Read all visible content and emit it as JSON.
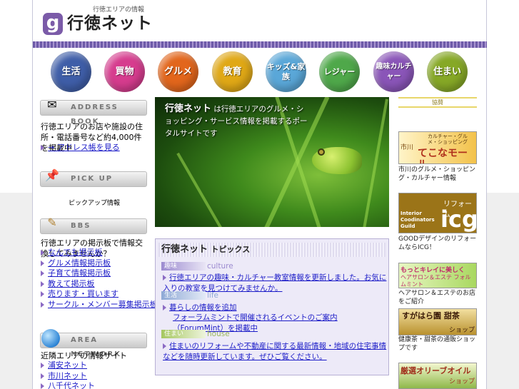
{
  "header": {
    "tagline": "行徳エリアの情報",
    "logo_letter": "g",
    "logo_text": "行徳ネット"
  },
  "categories": [
    {
      "label": "生活",
      "icon": "building-icon",
      "color": "#3f5ea8"
    },
    {
      "label": "買物",
      "icon": "bag-icon",
      "color": "#d63c8e"
    },
    {
      "label": "グルメ",
      "icon": "fork-icon",
      "color": "#e2661c"
    },
    {
      "label": "教育",
      "icon": "pencil-icon",
      "color": "#e0a816"
    },
    {
      "label": "キッズ&家族",
      "icon": "kids-icon",
      "color": "#5aa7d8"
    },
    {
      "label": "レジャー",
      "icon": "leisure-icon",
      "color": "#4fa84a"
    },
    {
      "label": "趣味カルチャー",
      "icon": "culture-icon",
      "color": "#8a55b8"
    },
    {
      "label": "住まい",
      "icon": "house-icon",
      "color": "#86a826"
    }
  ],
  "sidebar": {
    "address": {
      "title": "ADDRESS BOOK",
      "description": "行徳エリアのお店や施設の住所・電話番号など約4,000件を掲載中",
      "link": "→ アドレス帳を見る"
    },
    "pickup": {
      "title": "PICK UP",
      "text": "ピックアップ情報"
    },
    "bbs": {
      "title": "BBS",
      "description": "行徳エリアの掲示板で情報交換してみませんか？",
      "links": [
        "なんでも掲示板",
        "グルメ情報掲示板",
        "子育て情報掲示板",
        "教えて掲示板",
        "売ります・買います",
        "サークル・メンバー募集掲示板"
      ]
    },
    "area": {
      "title": "AREA NETWORK",
      "description": "近隣エリアの情報サイト",
      "links": [
        "浦安ネット",
        "市川ネット",
        "八千代ネット"
      ]
    }
  },
  "hero": {
    "brand": "行徳ネット",
    "text": "は行徳エリアのグルメ・ショッピング・サービス情報を掲載するポータルサイトです"
  },
  "topics": {
    "title": "行徳ネット",
    "title_suffix": "トピックス",
    "items": [
      {
        "label": "趣味",
        "sub": "culture",
        "links": [
          "行徳エリアの趣味・カルチャー教室情報を更新しました。お気に入りの教室を見つけてみませんか。"
        ]
      },
      {
        "label": "生活",
        "sub": "life",
        "links": [
          "暮らしの情報を追加",
          "フォーラムミントで開催されるイベントのご案内（ForumMint）を掲載中"
        ]
      },
      {
        "label": "住まい",
        "sub": "house",
        "links": [
          "住まいのリフォームや不動産に関する最新情報・地域の住宅事情などを随時更新しています。ぜひご覧ください。"
        ]
      }
    ]
  },
  "rightcol": {
    "heading": "協賛",
    "banners": [
      {
        "title": "てこなモール",
        "sub": "カルチャー・グルメ・ショッピング",
        "area": "市川",
        "caption": "市川のグルメ・ショッピング・カルチャー情報"
      },
      {
        "title": "icg",
        "sub": "Interior Coodinators Guild",
        "extra": "リフォーム",
        "caption": "GOODデザインのリフォームならICG！"
      },
      {
        "title": "もっとキレイに美しく",
        "sub": "ヘアサロン＆エステ フォルムミント",
        "caption": "ヘアサロン＆エステのお店をご紹介"
      },
      {
        "title": "すがはら園 甜茶",
        "sub": "ショップ",
        "caption": "健康茶・甜茶の通販ショップです"
      },
      {
        "title": "厳選オリーブオイル",
        "sub": "ショップ",
        "caption": ""
      }
    ]
  }
}
